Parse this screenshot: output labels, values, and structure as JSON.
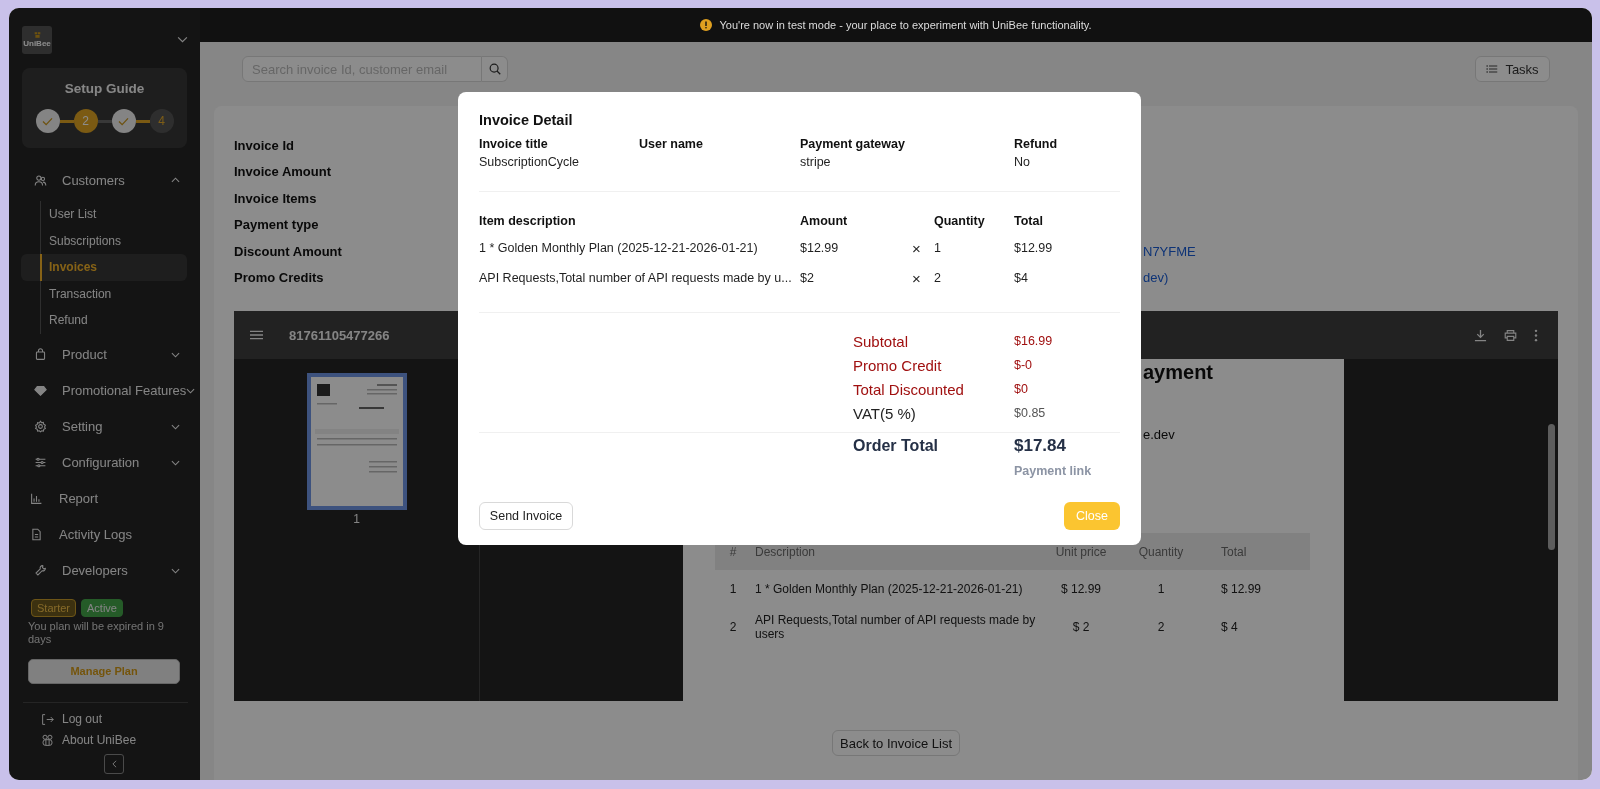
{
  "banner": {
    "text": "You're now in test mode - your place to experiment with UniBee functionality."
  },
  "sidebar": {
    "logo": "UniBee",
    "setup_guide": {
      "title": "Setup Guide",
      "steps": [
        {
          "done": true,
          "current": false
        },
        {
          "label": "2",
          "done": false,
          "current": true
        },
        {
          "done": true,
          "current": false
        },
        {
          "label": "4",
          "done": false,
          "current": false
        }
      ]
    },
    "nav": [
      {
        "label": "Customers",
        "kind": "group",
        "expanded": true,
        "children": [
          {
            "label": "User List",
            "selected": false
          },
          {
            "label": "Subscriptions",
            "selected": false
          },
          {
            "label": "Invoices",
            "selected": true
          },
          {
            "label": "Transaction",
            "selected": false
          },
          {
            "label": "Refund",
            "selected": false
          }
        ]
      },
      {
        "label": "Product",
        "kind": "group",
        "expanded": false
      },
      {
        "label": "Promotional Features",
        "kind": "group",
        "expanded": false
      },
      {
        "label": "Setting",
        "kind": "group",
        "expanded": false
      },
      {
        "label": "Configuration",
        "kind": "group",
        "expanded": false
      },
      {
        "label": "Report",
        "kind": "link"
      },
      {
        "label": "Activity Logs",
        "kind": "link"
      },
      {
        "label": "Developers",
        "kind": "group",
        "expanded": false
      }
    ],
    "plan": {
      "badges": [
        {
          "label": "Starter",
          "kind": "plan"
        },
        {
          "label": "Active",
          "kind": "status"
        }
      ],
      "notice": "You plan will be expired in 9 days",
      "button": "Manage Plan"
    },
    "footer": [
      "Log out",
      "About UniBee"
    ]
  },
  "header": {
    "search": {
      "placeholder": "Search invoice Id, customer email"
    },
    "tasks_button": "Tasks"
  },
  "detail": {
    "rows": [
      {
        "label": "Invoice Id"
      },
      {
        "label": "Invoice Amount"
      },
      {
        "label": "Invoice Items"
      },
      {
        "label": "Payment type"
      },
      {
        "label": "Discount Amount",
        "value": "N7YFME"
      },
      {
        "label": "Promo Credits",
        "value": "dev)"
      }
    ]
  },
  "pdf_viewer": {
    "title": "81761105477266",
    "thumbnail_label": "1",
    "page": {
      "heading": "ayment",
      "line": "e.dev",
      "table": {
        "columns": [
          "#",
          "Description",
          "Unit price",
          "Quantity",
          "Total"
        ],
        "rows": [
          [
            "1",
            "1 * Golden Monthly Plan (2025-12-21-2026-01-21)",
            "$ 12.99",
            "1",
            "$ 12.99"
          ],
          [
            "2",
            "API Requests,Total number of API requests made by users",
            "$ 2",
            "2",
            "$ 4"
          ]
        ]
      }
    }
  },
  "back_button": "Back to Invoice List",
  "modal": {
    "title": "Invoice Detail",
    "fields": [
      {
        "label": "Invoice title",
        "value": "SubscriptionCycle"
      },
      {
        "label": "User name"
      },
      {
        "label": "Payment gateway",
        "value": "stripe"
      },
      {
        "label": "Refund",
        "value": "No"
      }
    ],
    "items": {
      "columns": [
        "Item description",
        "Amount",
        "Quantity",
        "Total"
      ],
      "rows": [
        {
          "description": "1 * Golden Monthly Plan (2025-12-21-2026-01-21)",
          "amount": "$12.99",
          "times": "×",
          "quantity": "1",
          "total": "$12.99"
        },
        {
          "description": "API Requests,Total number of API requests made by u...",
          "amount": "$2",
          "times": "×",
          "quantity": "2",
          "total": "$4"
        }
      ]
    },
    "summary": [
      {
        "label": "Subtotal",
        "value": "$16.99",
        "kind": "accent"
      },
      {
        "label": "Promo Credit",
        "value": "$-0",
        "kind": "accent"
      },
      {
        "label": "Total Discounted",
        "value": "$0",
        "kind": "accent"
      },
      {
        "label": "VAT(5 %)",
        "value": "$0.85",
        "kind": "plain"
      }
    ],
    "order_total": {
      "label": "Order Total",
      "value": "$17.84"
    },
    "payment_link": "Payment link",
    "send_button": "Send Invoice",
    "close_button": "Close"
  }
}
